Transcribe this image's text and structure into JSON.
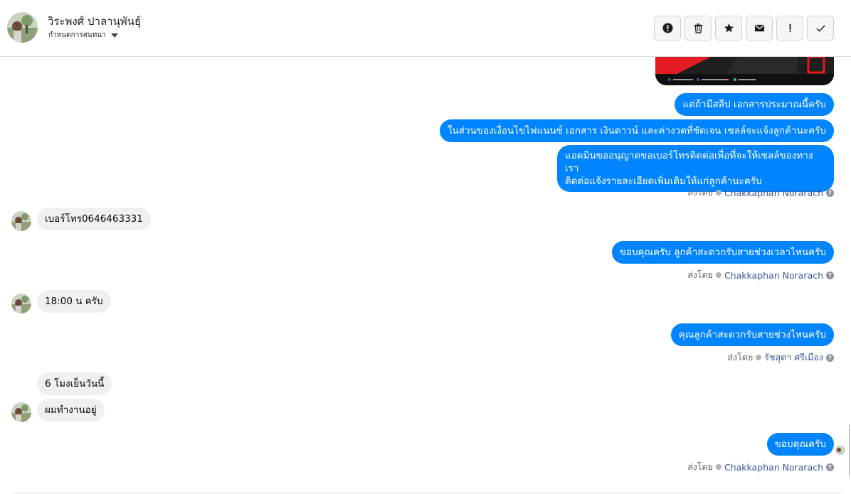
{
  "header": {
    "contact_name": "วิระพงศ์ ปาลานุพันธุ์",
    "conversation_settings": "กำหนดการสนทนา",
    "toolbar": [
      {
        "name": "spam-button",
        "icon": "alert-circle-icon"
      },
      {
        "name": "delete-button",
        "icon": "trash-icon"
      },
      {
        "name": "star-button",
        "icon": "star-icon"
      },
      {
        "name": "mark-unread-button",
        "icon": "envelope-icon"
      },
      {
        "name": "follow-up-button",
        "icon": "exclamation-icon"
      },
      {
        "name": "mark-done-button",
        "icon": "check-icon"
      }
    ]
  },
  "sent_by_label": "ส่งโดย",
  "messages": {
    "m1": "แต่ถ้ามีสลีป เอกสารประมาณนี้ครับ",
    "m2": "ในส่วนของเงื่อนไขไฟแนนซ์ เอกสาร เงินดาวน์ และค่างวดที่ชัดเจน เซลล์จะแจ้งลูกค้านะครับ",
    "m3_line1": "แอดมินขออนุญาตขอเบอร์โทรติดต่อเพื่อที่จะให้เซลล์ของทางเรา",
    "m3_line2": "ติดต่อแจ้งรายละเอียดเพิ่มเติมให้แก่ลูกค้านะครับ",
    "sender1": "Chakkaphan Norarach",
    "m4": "เบอร์โทร0646463331",
    "m5": "ขอบคุณครับ ลูกค้าสะดวกรับสายช่วงเวลาไหนครับ",
    "sender2": "Chakkaphan Norarach",
    "m6": "18:00 น ครับ",
    "m7": "คุณลูกค้าสะดวกรับสายช่วงไหนครับ",
    "sender3": "รัชสุดา ศรีเมือง",
    "m8": "6 โมงเย็นวันนี้",
    "m9": "ผมทำงานอยู่",
    "m10": "ขอบคุณครับ",
    "sender4": "Chakkaphan Norarach"
  },
  "colors": {
    "outgoing_bubble": "#0084ff",
    "incoming_bubble": "#f1f0f0",
    "sender_link": "#385898"
  }
}
